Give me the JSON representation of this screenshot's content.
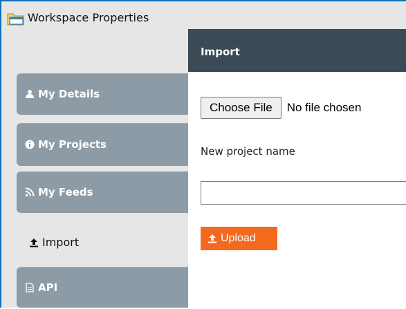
{
  "window": {
    "title": "Workspace Properties",
    "icon": "folder-icon"
  },
  "sidebar": {
    "items": [
      {
        "label": "My Details",
        "icon": "user-icon",
        "active": false
      },
      {
        "label": "My Projects",
        "icon": "info-circle-icon",
        "active": false
      },
      {
        "label": "My Feeds",
        "icon": "rss-icon",
        "active": false
      },
      {
        "label": "Import",
        "icon": "upload-icon",
        "active": true
      },
      {
        "label": "API",
        "icon": "document-icon",
        "active": false
      }
    ]
  },
  "panel": {
    "header": "Import",
    "file_input": {
      "button_label": "Choose File",
      "status_text": "No file chosen"
    },
    "project_name_label": "New project name",
    "project_name_value": "",
    "upload_label": "Upload"
  },
  "colors": {
    "tab_bg": "#8d9ba6",
    "header_bg": "#3b4a55",
    "upload_bg": "#f36a1f",
    "window_border": "#0b6fb8"
  }
}
